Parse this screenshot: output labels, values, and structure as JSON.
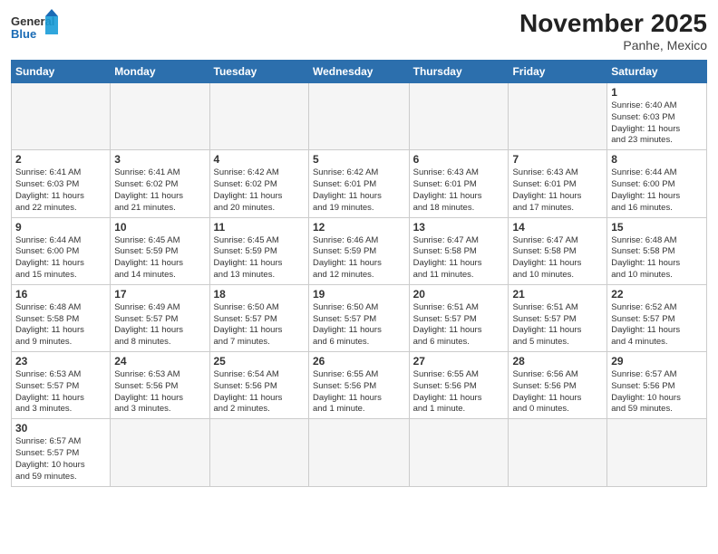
{
  "header": {
    "title": "November 2025",
    "subtitle": "Panhe, Mexico",
    "logo_general": "General",
    "logo_blue": "Blue"
  },
  "weekdays": [
    "Sunday",
    "Monday",
    "Tuesday",
    "Wednesday",
    "Thursday",
    "Friday",
    "Saturday"
  ],
  "weeks": [
    [
      {
        "day": "",
        "info": ""
      },
      {
        "day": "",
        "info": ""
      },
      {
        "day": "",
        "info": ""
      },
      {
        "day": "",
        "info": ""
      },
      {
        "day": "",
        "info": ""
      },
      {
        "day": "",
        "info": ""
      },
      {
        "day": "1",
        "info": "Sunrise: 6:40 AM\nSunset: 6:03 PM\nDaylight: 11 hours\nand 23 minutes."
      }
    ],
    [
      {
        "day": "2",
        "info": "Sunrise: 6:41 AM\nSunset: 6:03 PM\nDaylight: 11 hours\nand 22 minutes."
      },
      {
        "day": "3",
        "info": "Sunrise: 6:41 AM\nSunset: 6:02 PM\nDaylight: 11 hours\nand 21 minutes."
      },
      {
        "day": "4",
        "info": "Sunrise: 6:42 AM\nSunset: 6:02 PM\nDaylight: 11 hours\nand 20 minutes."
      },
      {
        "day": "5",
        "info": "Sunrise: 6:42 AM\nSunset: 6:01 PM\nDaylight: 11 hours\nand 19 minutes."
      },
      {
        "day": "6",
        "info": "Sunrise: 6:43 AM\nSunset: 6:01 PM\nDaylight: 11 hours\nand 18 minutes."
      },
      {
        "day": "7",
        "info": "Sunrise: 6:43 AM\nSunset: 6:01 PM\nDaylight: 11 hours\nand 17 minutes."
      },
      {
        "day": "8",
        "info": "Sunrise: 6:44 AM\nSunset: 6:00 PM\nDaylight: 11 hours\nand 16 minutes."
      }
    ],
    [
      {
        "day": "9",
        "info": "Sunrise: 6:44 AM\nSunset: 6:00 PM\nDaylight: 11 hours\nand 15 minutes."
      },
      {
        "day": "10",
        "info": "Sunrise: 6:45 AM\nSunset: 5:59 PM\nDaylight: 11 hours\nand 14 minutes."
      },
      {
        "day": "11",
        "info": "Sunrise: 6:45 AM\nSunset: 5:59 PM\nDaylight: 11 hours\nand 13 minutes."
      },
      {
        "day": "12",
        "info": "Sunrise: 6:46 AM\nSunset: 5:59 PM\nDaylight: 11 hours\nand 12 minutes."
      },
      {
        "day": "13",
        "info": "Sunrise: 6:47 AM\nSunset: 5:58 PM\nDaylight: 11 hours\nand 11 minutes."
      },
      {
        "day": "14",
        "info": "Sunrise: 6:47 AM\nSunset: 5:58 PM\nDaylight: 11 hours\nand 10 minutes."
      },
      {
        "day": "15",
        "info": "Sunrise: 6:48 AM\nSunset: 5:58 PM\nDaylight: 11 hours\nand 10 minutes."
      }
    ],
    [
      {
        "day": "16",
        "info": "Sunrise: 6:48 AM\nSunset: 5:58 PM\nDaylight: 11 hours\nand 9 minutes."
      },
      {
        "day": "17",
        "info": "Sunrise: 6:49 AM\nSunset: 5:57 PM\nDaylight: 11 hours\nand 8 minutes."
      },
      {
        "day": "18",
        "info": "Sunrise: 6:50 AM\nSunset: 5:57 PM\nDaylight: 11 hours\nand 7 minutes."
      },
      {
        "day": "19",
        "info": "Sunrise: 6:50 AM\nSunset: 5:57 PM\nDaylight: 11 hours\nand 6 minutes."
      },
      {
        "day": "20",
        "info": "Sunrise: 6:51 AM\nSunset: 5:57 PM\nDaylight: 11 hours\nand 6 minutes."
      },
      {
        "day": "21",
        "info": "Sunrise: 6:51 AM\nSunset: 5:57 PM\nDaylight: 11 hours\nand 5 minutes."
      },
      {
        "day": "22",
        "info": "Sunrise: 6:52 AM\nSunset: 5:57 PM\nDaylight: 11 hours\nand 4 minutes."
      }
    ],
    [
      {
        "day": "23",
        "info": "Sunrise: 6:53 AM\nSunset: 5:57 PM\nDaylight: 11 hours\nand 3 minutes."
      },
      {
        "day": "24",
        "info": "Sunrise: 6:53 AM\nSunset: 5:56 PM\nDaylight: 11 hours\nand 3 minutes."
      },
      {
        "day": "25",
        "info": "Sunrise: 6:54 AM\nSunset: 5:56 PM\nDaylight: 11 hours\nand 2 minutes."
      },
      {
        "day": "26",
        "info": "Sunrise: 6:55 AM\nSunset: 5:56 PM\nDaylight: 11 hours\nand 1 minute."
      },
      {
        "day": "27",
        "info": "Sunrise: 6:55 AM\nSunset: 5:56 PM\nDaylight: 11 hours\nand 1 minute."
      },
      {
        "day": "28",
        "info": "Sunrise: 6:56 AM\nSunset: 5:56 PM\nDaylight: 11 hours\nand 0 minutes."
      },
      {
        "day": "29",
        "info": "Sunrise: 6:57 AM\nSunset: 5:56 PM\nDaylight: 10 hours\nand 59 minutes."
      }
    ],
    [
      {
        "day": "30",
        "info": "Sunrise: 6:57 AM\nSunset: 5:57 PM\nDaylight: 10 hours\nand 59 minutes."
      },
      {
        "day": "",
        "info": ""
      },
      {
        "day": "",
        "info": ""
      },
      {
        "day": "",
        "info": ""
      },
      {
        "day": "",
        "info": ""
      },
      {
        "day": "",
        "info": ""
      },
      {
        "day": "",
        "info": ""
      }
    ]
  ]
}
